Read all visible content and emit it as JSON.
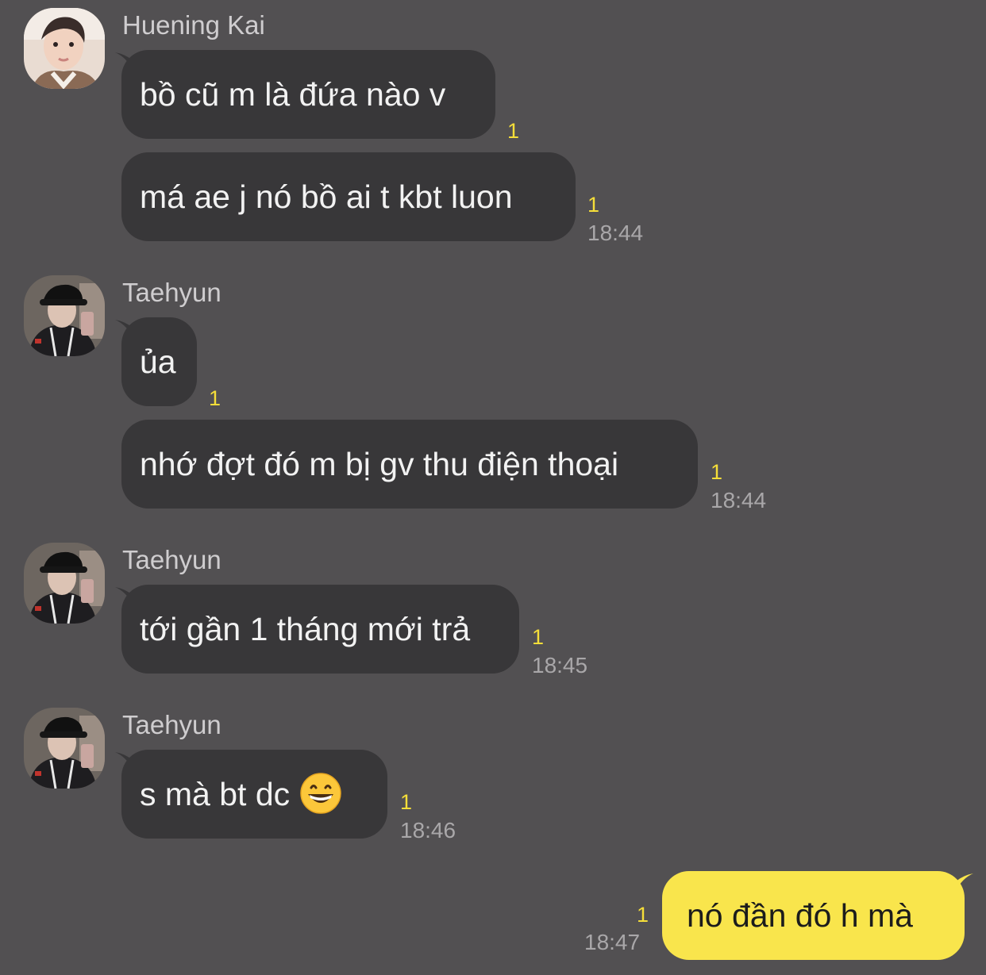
{
  "messages": [
    {
      "sender": "Huening Kai",
      "lines": [
        {
          "text": "bồ cũ m là đứa nào v",
          "unread": "1",
          "time": ""
        },
        {
          "text": "má ae j nó bồ ai t kbt luon",
          "unread": "1",
          "time": "18:44"
        }
      ]
    },
    {
      "sender": "Taehyun",
      "lines": [
        {
          "text": "ủa",
          "unread": "1",
          "time": ""
        },
        {
          "text": "nhớ đợt đó m bị gv thu điện thoại",
          "unread": "1",
          "time": "18:44"
        }
      ]
    },
    {
      "sender": "Taehyun",
      "lines": [
        {
          "text": "tới gần 1 tháng mới trả",
          "unread": "1",
          "time": "18:45"
        }
      ]
    },
    {
      "sender": "Taehyun",
      "lines": [
        {
          "text": "s mà bt dc ",
          "emoji": "grinning-face-emoji",
          "unread": "1",
          "time": "18:46"
        }
      ]
    }
  ],
  "outgoing": {
    "text": "nó đần đó h mà",
    "unread": "1",
    "time": "18:47"
  },
  "colors": {
    "background": "#525052",
    "incoming_bubble": "#383739",
    "outgoing_bubble": "#f9e54c",
    "unread": "#f5de39"
  }
}
